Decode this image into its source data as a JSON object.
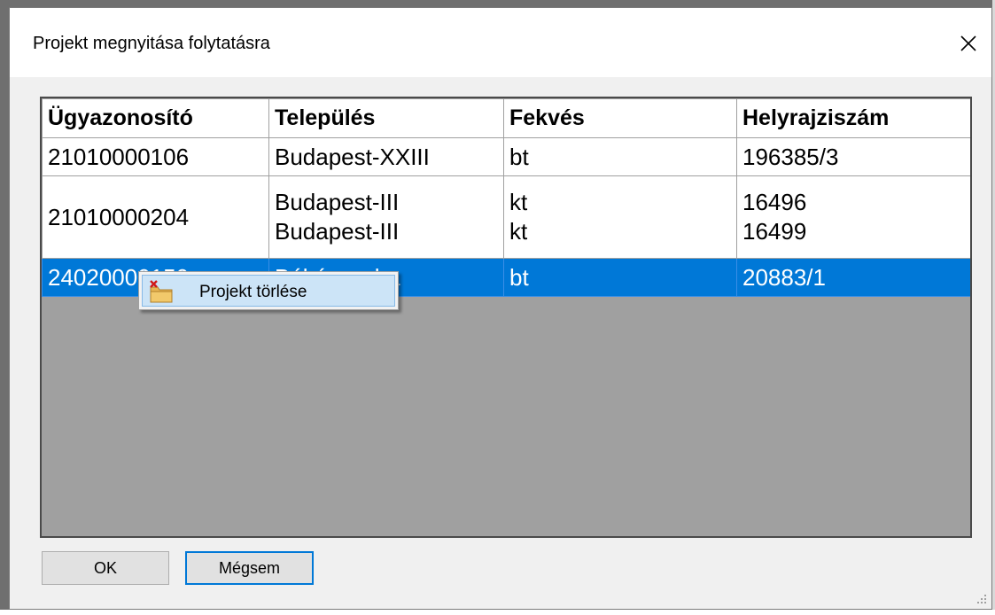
{
  "window": {
    "title": "Projekt megnyitása folytatásra",
    "close_icon": "close-icon"
  },
  "grid": {
    "columns": [
      "Ügyazonosító",
      "Település",
      "Fekvés",
      "Helyrajziszám"
    ],
    "rows": [
      {
        "id": "21010000106",
        "telepules": [
          "Budapest-XXIII"
        ],
        "fekves": [
          "bt"
        ],
        "hrsz": [
          "196385/3"
        ],
        "selected": false
      },
      {
        "id": "21010000204",
        "telepules": [
          "Budapest-III",
          "Budapest-III"
        ],
        "fekves": [
          "kt",
          "kt"
        ],
        "hrsz": [
          "16496",
          "16499"
        ],
        "selected": false
      },
      {
        "id": "24020000150",
        "telepules": [
          "Békéscsaba"
        ],
        "fekves": [
          "bt"
        ],
        "hrsz": [
          "20883/1"
        ],
        "selected": true
      }
    ]
  },
  "context_menu": {
    "items": [
      {
        "label": "Projekt törlése",
        "icon": "delete-project-icon"
      }
    ]
  },
  "buttons": {
    "ok_label": "OK",
    "cancel_label": "Mégsem"
  },
  "colors": {
    "selection": "#0078d7",
    "menu_highlight": "#cce4f7",
    "grid_background": "#a0a0a0"
  }
}
